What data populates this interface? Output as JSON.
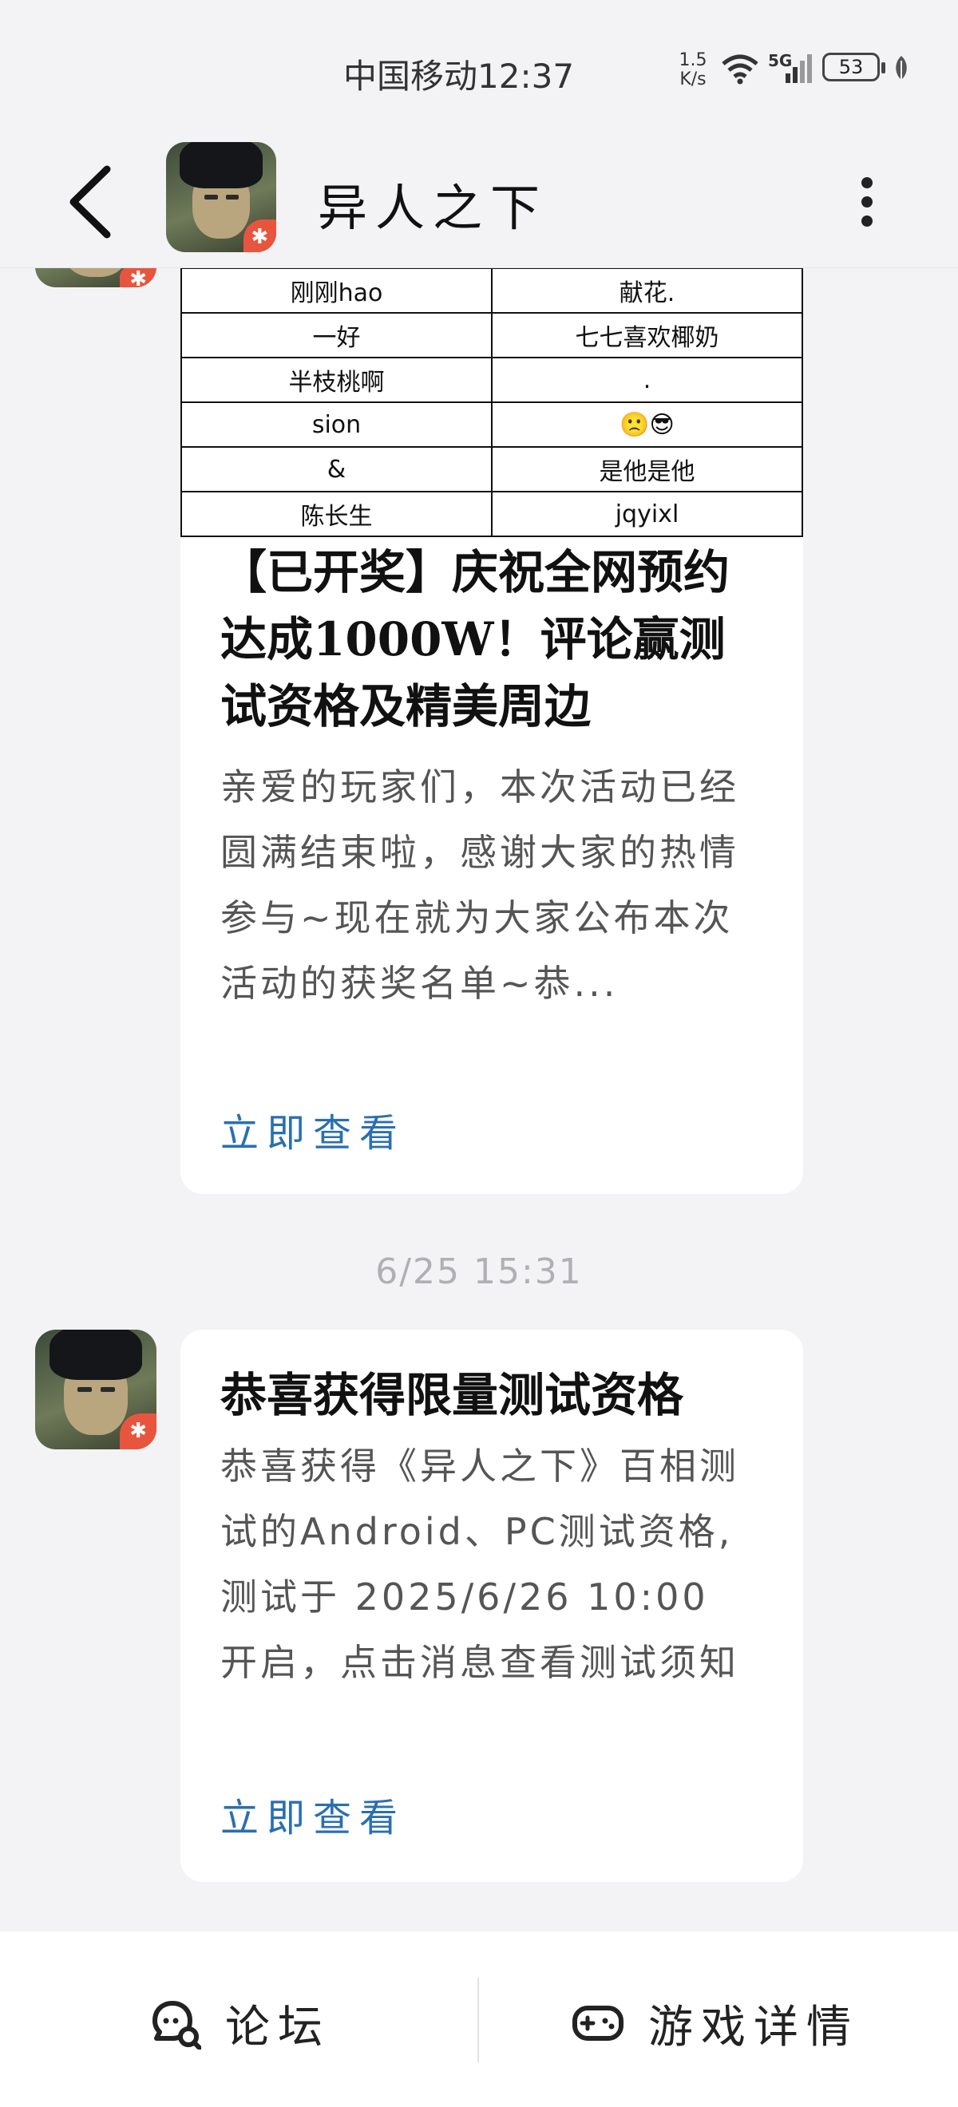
{
  "status_bar": {
    "carrier_time": "中国移动12:37",
    "net_speed_value": "1.5",
    "net_speed_unit": "K/s",
    "network_type": "5G",
    "battery": "53"
  },
  "header": {
    "title": "异人之下"
  },
  "winners_table": [
    [
      "刚刚hao",
      "献花."
    ],
    [
      "一好",
      "七七喜欢椰奶"
    ],
    [
      "半枝桃啊",
      "."
    ],
    [
      "sion",
      "🙁😎"
    ],
    [
      "&",
      "是他是他"
    ],
    [
      "陈长生",
      "jqyixl"
    ]
  ],
  "messages": [
    {
      "title": "【已开奖】庆祝全网预约达成1000W！评论赢测试资格及精美周边",
      "body": "亲爱的玩家们，本次活动已经圆满结束啦，感谢大家的热情参与~现在就为大家公布本次活动的获奖名单~恭...",
      "link": "立即查看"
    },
    {
      "timestamp": "6/25 15:31",
      "title": "恭喜获得限量测试资格",
      "body": "恭喜获得《异人之下》百相测试的Android、PC测试资格,测试于 2025/6/26 10:00 开启，点击消息查看测试须知",
      "link": "立即查看"
    }
  ],
  "bottom_bar": {
    "forum_label": "论坛",
    "game_label": "游戏详情"
  },
  "colors": {
    "background": "#f3f3f5",
    "card": "#ffffff",
    "link": "#2a6fb0",
    "timestamp": "#b0b0b4"
  }
}
